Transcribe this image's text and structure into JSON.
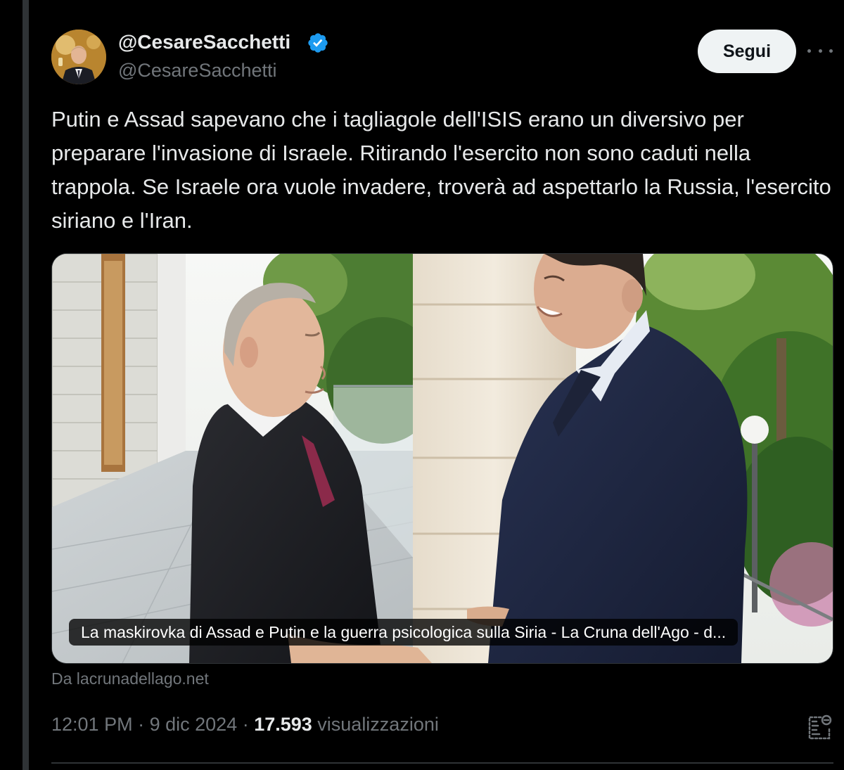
{
  "author": {
    "display_name": "@CesareSacchetti",
    "handle": "@CesareSacchetti",
    "verified": true
  },
  "follow_button_label": "Segui",
  "more_icon": "more-horizontal-icon",
  "tweet": {
    "text": "Putin e Assad sapevano che i tagliagole dell'ISIS erano un diversivo per preparare l'invasione di Israele. Ritirando l'esercito non sono caduti nella trappola. Se Israele ora vuole invadere, troverà ad aspettarlo la Russia, l'esercito siriano e l'Iran."
  },
  "link_card": {
    "title": "La maskirovka di Assad e Putin e la guerra psicologica sulla Siria - La Cruna dell'Ago - d...",
    "source": "Da lacrunadellago.net"
  },
  "meta": {
    "time": "12:01 PM",
    "separator1": " · ",
    "date": "9 dic 2024",
    "separator2": " · ",
    "views_count": "17.593",
    "views_label": " visualizzazioni"
  },
  "icons": {
    "verified": "verified-badge-icon",
    "analytics": "analytics-icon"
  },
  "colors": {
    "background": "#000000",
    "text_primary": "#e7e9ea",
    "text_secondary": "#71767b",
    "verified_blue": "#1d9bf0",
    "follow_button_bg": "#eff3f4",
    "border": "#2f3336"
  }
}
